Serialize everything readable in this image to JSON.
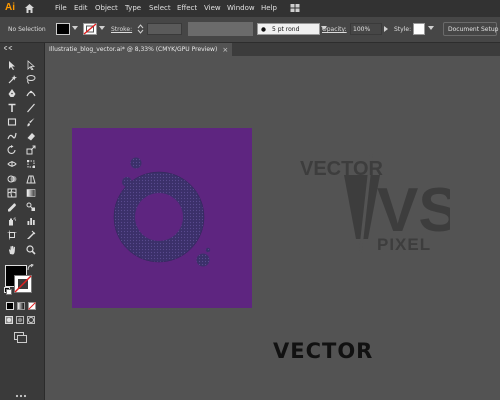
{
  "app": {
    "logo": "Ai"
  },
  "menu": [
    "File",
    "Edit",
    "Object",
    "Type",
    "Select",
    "Effect",
    "View",
    "Window",
    "Help"
  ],
  "control_bar": {
    "selection": "No Selection",
    "stroke_label": "Stroke:",
    "brush": "5 pt rond",
    "opacity_label": "Opacity:",
    "opacity_value": "100%",
    "style_label": "Style:",
    "document_setup": "Document Setup"
  },
  "document": {
    "tab_title": "Illustratie_blog_vector.ai* @ 8,33% (CMYK/GPU Preview)",
    "close": "×"
  },
  "canvas": {
    "logo_top": "VECTOR",
    "logo_vs": "VS",
    "logo_bottom": "PIXEL",
    "vector_label": "VECTOR"
  },
  "colors": {
    "artboard": "#5e2580",
    "ring": "#3b306a",
    "logo": "#3d3d3d",
    "accent": "#ff9a00"
  },
  "toolbar_icons": [
    "selection-tool",
    "direct-selection-tool",
    "magic-wand-tool",
    "lasso-tool",
    "pen-tool",
    "curvature-tool",
    "type-tool",
    "line-tool",
    "rectangle-tool",
    "paintbrush-tool",
    "shaper-tool",
    "eraser-tool",
    "rotate-tool",
    "scale-tool",
    "width-tool",
    "free-transform-tool",
    "shape-builder-tool",
    "perspective-tool",
    "mesh-tool",
    "gradient-tool",
    "eyedropper-tool",
    "blend-tool",
    "symbol-sprayer-tool",
    "graph-tool",
    "artboard-tool",
    "slice-tool",
    "hand-tool",
    "zoom-tool"
  ]
}
